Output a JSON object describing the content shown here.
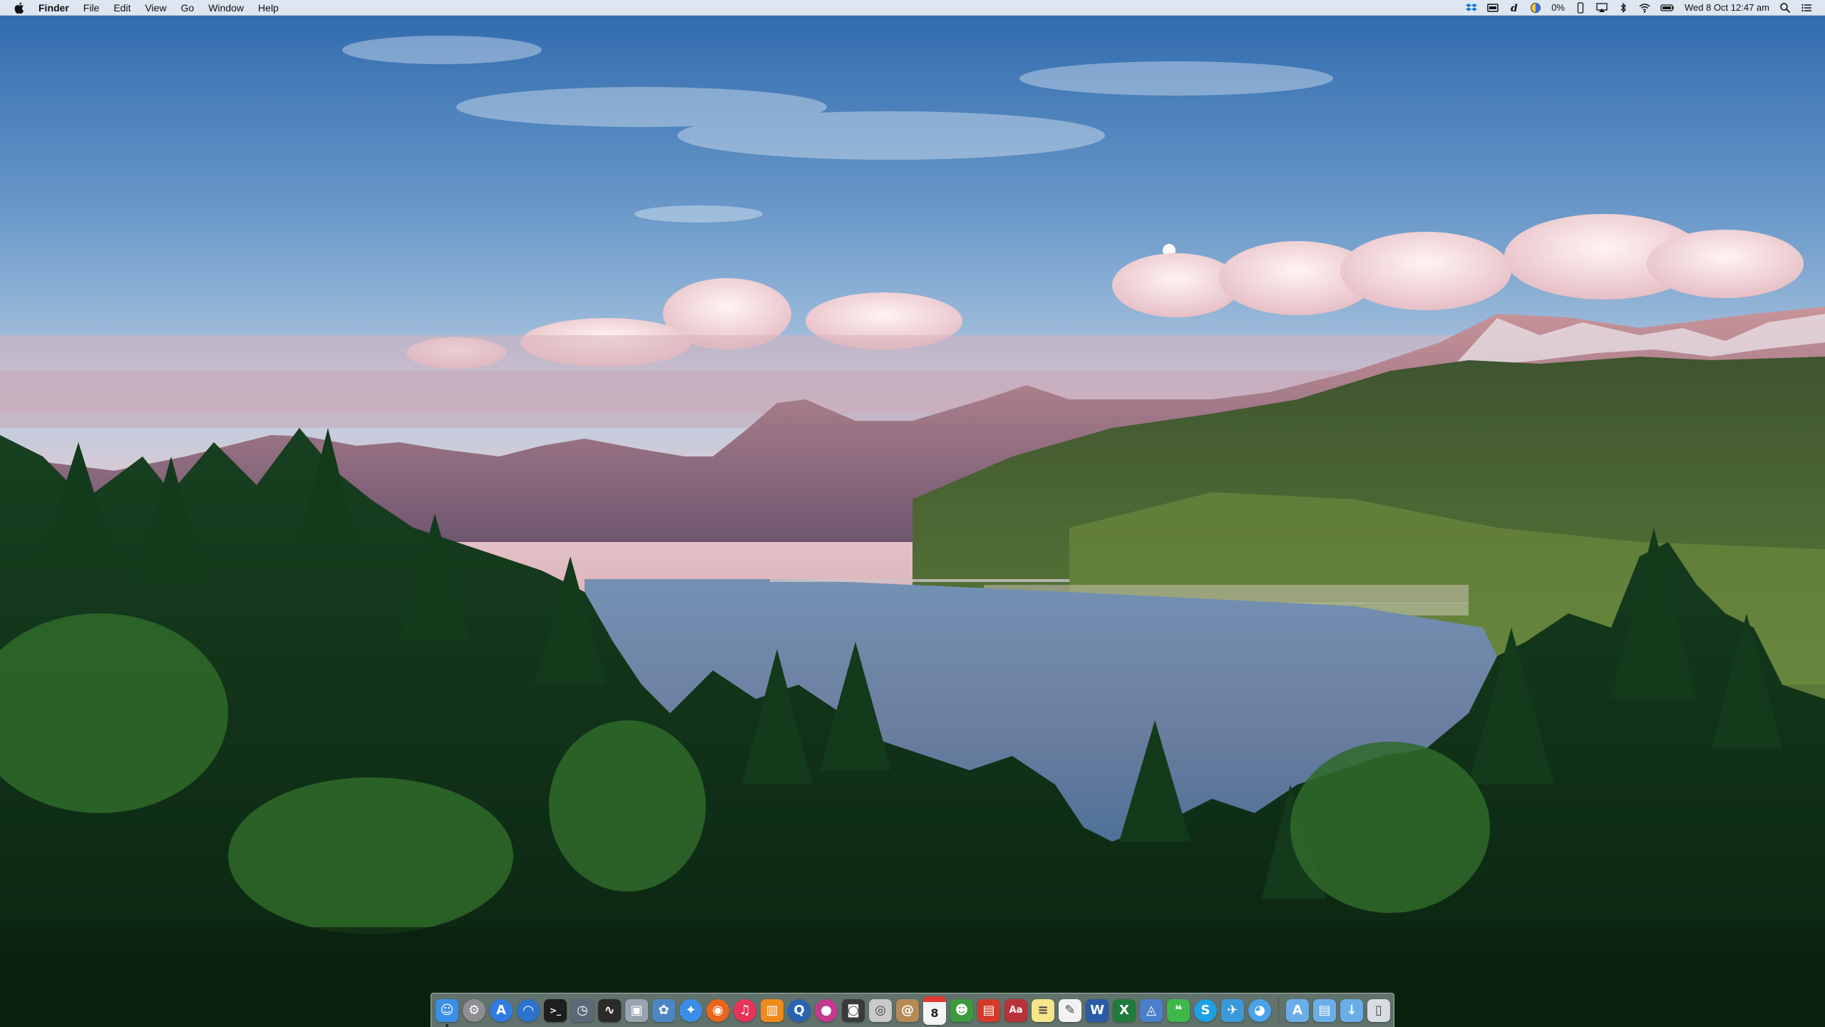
{
  "menubar": {
    "app_name": "Finder",
    "menus": [
      "File",
      "Edit",
      "View",
      "Go",
      "Window",
      "Help"
    ],
    "battery_percent": "0%",
    "clock": "Wed 8 Oct  12:47 am"
  },
  "calendar_day": "8",
  "dock": {
    "apps": [
      {
        "name": "Finder",
        "icon": "finder-icon",
        "color": "#3a8ee6",
        "running": true
      },
      {
        "name": "System Preferences",
        "icon": "gear-icon",
        "color": "#8e8e93"
      },
      {
        "name": "App Store",
        "icon": "app-store-icon",
        "color": "#2f7de1"
      },
      {
        "name": "Wi-Fi Utility",
        "icon": "wifi-icon",
        "color": "#2a74c9"
      },
      {
        "name": "Terminal",
        "icon": "terminal-icon",
        "color": "#1e1e1e"
      },
      {
        "name": "Time Machine",
        "icon": "time-machine-icon",
        "color": "#5a6a78"
      },
      {
        "name": "Activity Monitor",
        "icon": "activity-monitor-icon",
        "color": "#2b2b2b"
      },
      {
        "name": "Preview",
        "icon": "preview-icon",
        "color": "#9aa4b0"
      },
      {
        "name": "Photos",
        "icon": "photos-icon",
        "color": "#4e86c4"
      },
      {
        "name": "Safari",
        "icon": "safari-icon",
        "color": "#3b8ee8"
      },
      {
        "name": "Firefox",
        "icon": "firefox-icon",
        "color": "#e8661d"
      },
      {
        "name": "iTunes",
        "icon": "music-icon",
        "color": "#e8335a"
      },
      {
        "name": "iBooks",
        "icon": "books-icon",
        "color": "#f08a1c"
      },
      {
        "name": "QuickTime",
        "icon": "quicktime-icon",
        "color": "#2864b4"
      },
      {
        "name": "Game Center",
        "icon": "game-center-icon",
        "color": "#c43b8e"
      },
      {
        "name": "Photo Booth",
        "icon": "photo-booth-icon",
        "color": "#3a3a3a"
      },
      {
        "name": "Image Capture",
        "icon": "image-capture-icon",
        "color": "#c9c9c9"
      },
      {
        "name": "Contacts",
        "icon": "contacts-icon",
        "color": "#b58a55"
      },
      {
        "name": "Calendar",
        "icon": "calendar-icon",
        "color": "#f4f4f4"
      },
      {
        "name": "Messages Old",
        "icon": "chat-icon",
        "color": "#3d9a3d"
      },
      {
        "name": "Flashcards",
        "icon": "flashcards-icon",
        "color": "#d23a2a"
      },
      {
        "name": "Dictionary",
        "icon": "dictionary-icon",
        "color": "#b8323a"
      },
      {
        "name": "Notes",
        "icon": "notes-icon",
        "color": "#f7e58a"
      },
      {
        "name": "TextEdit",
        "icon": "textedit-icon",
        "color": "#f2f2f2"
      },
      {
        "name": "Word",
        "icon": "word-icon",
        "color": "#2a5aa8"
      },
      {
        "name": "Excel",
        "icon": "excel-icon",
        "color": "#1f7a3c"
      },
      {
        "name": "Keynote",
        "icon": "keynote-icon",
        "color": "#4a7fc9"
      },
      {
        "name": "Messages",
        "icon": "messages-icon",
        "color": "#3fb84a"
      },
      {
        "name": "Skype",
        "icon": "skype-icon",
        "color": "#1ea1e3"
      },
      {
        "name": "Twitter",
        "icon": "twitter-icon",
        "color": "#3a9ad9"
      },
      {
        "name": "Tweetbot",
        "icon": "tweetbot-icon",
        "color": "#4aa3e8"
      }
    ],
    "folders": [
      {
        "name": "Applications",
        "icon": "applications-folder-icon",
        "color": "#6aaee8"
      },
      {
        "name": "Documents",
        "icon": "documents-folder-icon",
        "color": "#6aaee8"
      },
      {
        "name": "Downloads",
        "icon": "downloads-folder-icon",
        "color": "#6aaee8"
      },
      {
        "name": "Trash",
        "icon": "trash-icon",
        "color": "#d8dde2"
      }
    ]
  },
  "colors": {
    "sky_top": "#2f6fb4",
    "sky_mid": "#8fb3d6",
    "horizon_pink": "#e9c3c8",
    "lake": "#5a7fa6",
    "forest_dark": "#0e2a14",
    "forest_mid": "#1d4a22",
    "mountain_purple": "#8a6e86",
    "hill_green": "#4d6a2e"
  }
}
